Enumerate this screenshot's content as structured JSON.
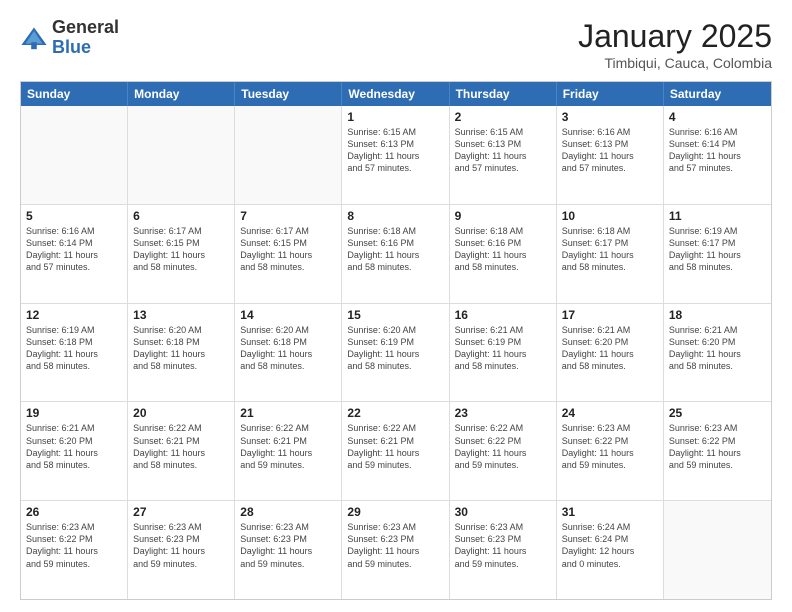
{
  "logo": {
    "general": "General",
    "blue": "Blue"
  },
  "title": "January 2025",
  "subtitle": "Timbiqui, Cauca, Colombia",
  "header": {
    "days": [
      "Sunday",
      "Monday",
      "Tuesday",
      "Wednesday",
      "Thursday",
      "Friday",
      "Saturday"
    ]
  },
  "weeks": [
    [
      {
        "day": "",
        "info": "",
        "empty": true
      },
      {
        "day": "",
        "info": "",
        "empty": true
      },
      {
        "day": "",
        "info": "",
        "empty": true
      },
      {
        "day": "1",
        "info": "Sunrise: 6:15 AM\nSunset: 6:13 PM\nDaylight: 11 hours\nand 57 minutes."
      },
      {
        "day": "2",
        "info": "Sunrise: 6:15 AM\nSunset: 6:13 PM\nDaylight: 11 hours\nand 57 minutes."
      },
      {
        "day": "3",
        "info": "Sunrise: 6:16 AM\nSunset: 6:13 PM\nDaylight: 11 hours\nand 57 minutes."
      },
      {
        "day": "4",
        "info": "Sunrise: 6:16 AM\nSunset: 6:14 PM\nDaylight: 11 hours\nand 57 minutes."
      }
    ],
    [
      {
        "day": "5",
        "info": "Sunrise: 6:16 AM\nSunset: 6:14 PM\nDaylight: 11 hours\nand 57 minutes."
      },
      {
        "day": "6",
        "info": "Sunrise: 6:17 AM\nSunset: 6:15 PM\nDaylight: 11 hours\nand 58 minutes."
      },
      {
        "day": "7",
        "info": "Sunrise: 6:17 AM\nSunset: 6:15 PM\nDaylight: 11 hours\nand 58 minutes."
      },
      {
        "day": "8",
        "info": "Sunrise: 6:18 AM\nSunset: 6:16 PM\nDaylight: 11 hours\nand 58 minutes."
      },
      {
        "day": "9",
        "info": "Sunrise: 6:18 AM\nSunset: 6:16 PM\nDaylight: 11 hours\nand 58 minutes."
      },
      {
        "day": "10",
        "info": "Sunrise: 6:18 AM\nSunset: 6:17 PM\nDaylight: 11 hours\nand 58 minutes."
      },
      {
        "day": "11",
        "info": "Sunrise: 6:19 AM\nSunset: 6:17 PM\nDaylight: 11 hours\nand 58 minutes."
      }
    ],
    [
      {
        "day": "12",
        "info": "Sunrise: 6:19 AM\nSunset: 6:18 PM\nDaylight: 11 hours\nand 58 minutes."
      },
      {
        "day": "13",
        "info": "Sunrise: 6:20 AM\nSunset: 6:18 PM\nDaylight: 11 hours\nand 58 minutes."
      },
      {
        "day": "14",
        "info": "Sunrise: 6:20 AM\nSunset: 6:18 PM\nDaylight: 11 hours\nand 58 minutes."
      },
      {
        "day": "15",
        "info": "Sunrise: 6:20 AM\nSunset: 6:19 PM\nDaylight: 11 hours\nand 58 minutes."
      },
      {
        "day": "16",
        "info": "Sunrise: 6:21 AM\nSunset: 6:19 PM\nDaylight: 11 hours\nand 58 minutes."
      },
      {
        "day": "17",
        "info": "Sunrise: 6:21 AM\nSunset: 6:20 PM\nDaylight: 11 hours\nand 58 minutes."
      },
      {
        "day": "18",
        "info": "Sunrise: 6:21 AM\nSunset: 6:20 PM\nDaylight: 11 hours\nand 58 minutes."
      }
    ],
    [
      {
        "day": "19",
        "info": "Sunrise: 6:21 AM\nSunset: 6:20 PM\nDaylight: 11 hours\nand 58 minutes."
      },
      {
        "day": "20",
        "info": "Sunrise: 6:22 AM\nSunset: 6:21 PM\nDaylight: 11 hours\nand 58 minutes."
      },
      {
        "day": "21",
        "info": "Sunrise: 6:22 AM\nSunset: 6:21 PM\nDaylight: 11 hours\nand 59 minutes."
      },
      {
        "day": "22",
        "info": "Sunrise: 6:22 AM\nSunset: 6:21 PM\nDaylight: 11 hours\nand 59 minutes."
      },
      {
        "day": "23",
        "info": "Sunrise: 6:22 AM\nSunset: 6:22 PM\nDaylight: 11 hours\nand 59 minutes."
      },
      {
        "day": "24",
        "info": "Sunrise: 6:23 AM\nSunset: 6:22 PM\nDaylight: 11 hours\nand 59 minutes."
      },
      {
        "day": "25",
        "info": "Sunrise: 6:23 AM\nSunset: 6:22 PM\nDaylight: 11 hours\nand 59 minutes."
      }
    ],
    [
      {
        "day": "26",
        "info": "Sunrise: 6:23 AM\nSunset: 6:22 PM\nDaylight: 11 hours\nand 59 minutes."
      },
      {
        "day": "27",
        "info": "Sunrise: 6:23 AM\nSunset: 6:23 PM\nDaylight: 11 hours\nand 59 minutes."
      },
      {
        "day": "28",
        "info": "Sunrise: 6:23 AM\nSunset: 6:23 PM\nDaylight: 11 hours\nand 59 minutes."
      },
      {
        "day": "29",
        "info": "Sunrise: 6:23 AM\nSunset: 6:23 PM\nDaylight: 11 hours\nand 59 minutes."
      },
      {
        "day": "30",
        "info": "Sunrise: 6:23 AM\nSunset: 6:23 PM\nDaylight: 11 hours\nand 59 minutes."
      },
      {
        "day": "31",
        "info": "Sunrise: 6:24 AM\nSunset: 6:24 PM\nDaylight: 12 hours\nand 0 minutes."
      },
      {
        "day": "",
        "info": "",
        "empty": true
      }
    ]
  ]
}
